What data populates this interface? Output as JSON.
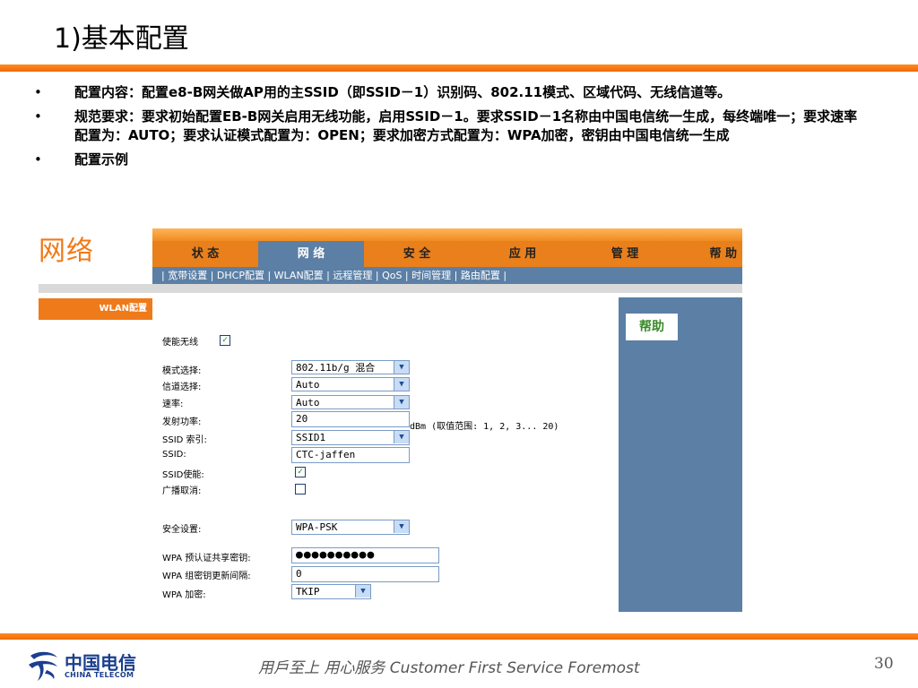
{
  "slide": {
    "title": "1)基本配置",
    "page_number": "30",
    "footer": "用戶至上  用心服务 Customer First Service Foremost",
    "brand_cn": "中国电信",
    "brand_en": "CHINA TELECOM"
  },
  "bullets": [
    {
      "text": "配置内容：配置e8-B网关做AP用的主SSID（即SSID－1）识别码、802.11模式、区域代码、无线信道等。"
    },
    {
      "text": "规范要求：要求初始配置EB-B网关启用无线功能，启用SSID－1。要求SSID－1名称由中国电信统一生成，每终端唯一；要求速率配置为：AUTO；要求认证模式配置为：OPEN；要求加密方式配置为：WPA加密，密钥由中国电信统一生成"
    },
    {
      "text": "配置示例"
    }
  ],
  "shot": {
    "logo": "网络",
    "nav": [
      "状 态",
      "网 络",
      "安 全",
      "应 用",
      "管 理",
      "帮 助"
    ],
    "sub_nav": "| 宽带设置 | DHCP配置 | WLAN配置 | 远程管理 | QoS | 时间管理 | 路由配置 |",
    "left_menu_item": "WLAN配置",
    "help_title": "帮助",
    "form": {
      "enable_wireless_label": "使能无线",
      "enable_wireless_checked": true,
      "mode_label": "模式选择:",
      "mode_value": "802.11b/g 混合",
      "channel_label": "信道选择:",
      "channel_value": "Auto",
      "rate_label": "速率:",
      "rate_value": "Auto",
      "power_label": "发射功率:",
      "power_value": "20",
      "power_unit": "dBm (取值范围: 1, 2, 3... 20)",
      "ssid_index_label": "SSID 索引:",
      "ssid_index_value": "SSID1",
      "ssid_label": "SSID:",
      "ssid_value": "CTC-jaffen",
      "ssid_enable_label": "SSID使能:",
      "ssid_enable_checked": true,
      "broadcast_cancel_label": "广播取消:",
      "broadcast_cancel_checked": false,
      "security_label": "安全设置:",
      "security_value": "WPA-PSK",
      "psk_label": "WPA 预认证共享密钥:",
      "psk_value": "●●●●●●●●●●",
      "rekey_label": "WPA 组密钥更新间隔:",
      "rekey_value": "0",
      "encryption_label": "WPA 加密:",
      "encryption_value": "TKIP"
    }
  }
}
